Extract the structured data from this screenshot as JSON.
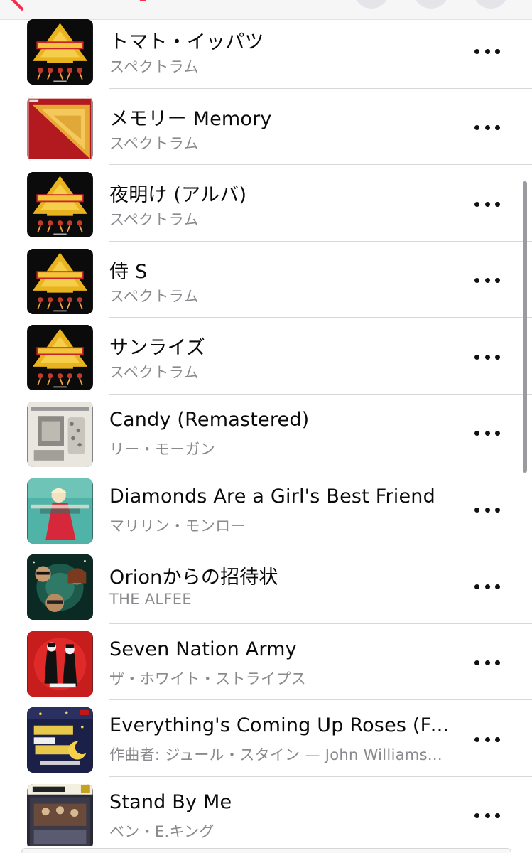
{
  "accent_color": "#fa2d48",
  "songs": [
    {
      "title": "トマト・イッパツ",
      "artist": "スペクトラム",
      "art": "spectrum"
    },
    {
      "title": "メモリー Memory",
      "artist": "スペクトラム",
      "art": "memory"
    },
    {
      "title": "夜明け (アルバ)",
      "artist": "スペクトラム",
      "art": "spectrum"
    },
    {
      "title": "侍 S",
      "artist": "スペクトラム",
      "art": "spectrum"
    },
    {
      "title": "サンライズ",
      "artist": "スペクトラム",
      "art": "spectrum"
    },
    {
      "title": "Candy (Remastered)",
      "artist": "リー・モーガン",
      "art": "candy"
    },
    {
      "title": "Diamonds Are a Girl's Best Friend",
      "artist": "マリリン・モンロー",
      "art": "marilyn"
    },
    {
      "title": "Orionからの招待状",
      "artist": "THE ALFEE",
      "art": "alfee"
    },
    {
      "title": "Seven Nation Army",
      "artist": "ザ・ホワイト・ストライプス",
      "art": "whitestripes"
    },
    {
      "title": "Everything's Coming Up Roses (Fr...",
      "artist": "作曲者: ジュール・スタイン — John Williams...",
      "art": "musicnight"
    },
    {
      "title": "Stand By Me",
      "artist": "ベン・E.キング",
      "art": "benking"
    }
  ],
  "icons": {
    "more": "ellipsis-icon",
    "back": "chevron-left-icon"
  }
}
